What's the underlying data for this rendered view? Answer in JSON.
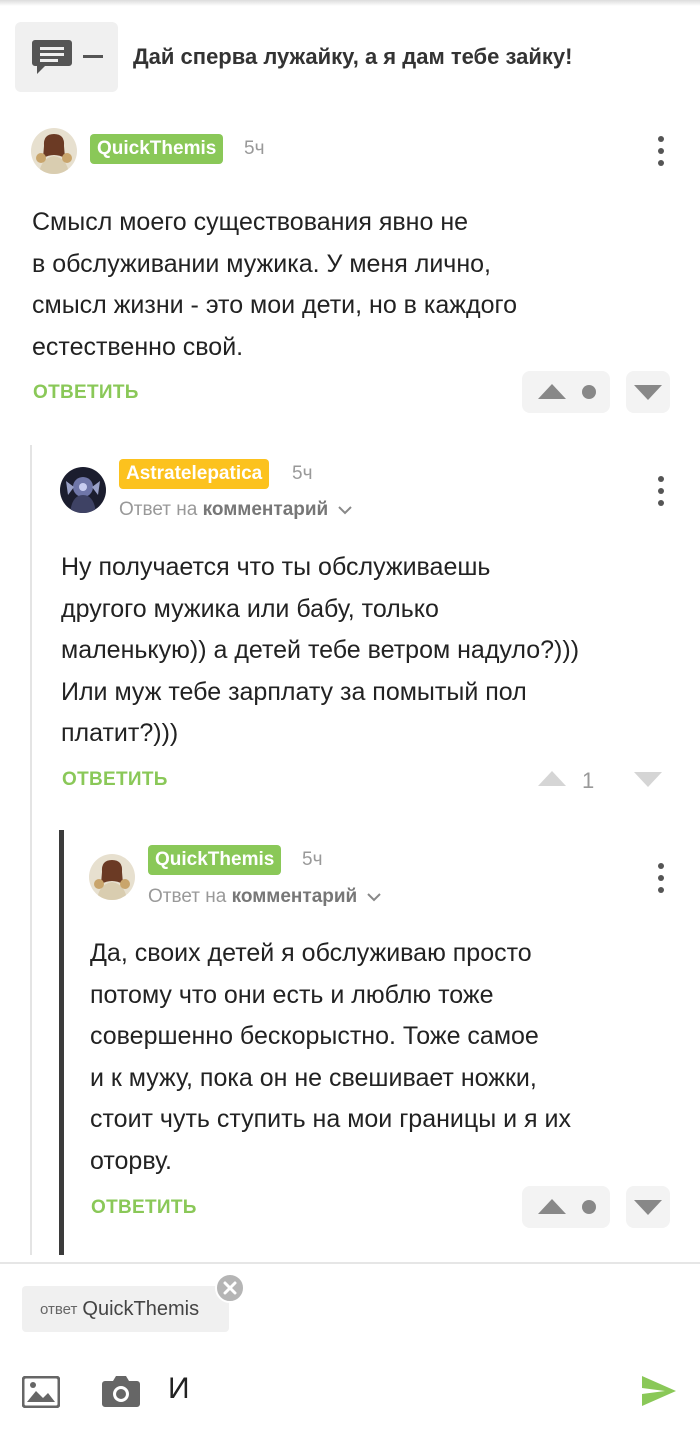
{
  "post": {
    "title": "Дай сперва лужайку, а я дам тебе зайку!"
  },
  "comments": [
    {
      "author": "QuickThemis",
      "time": "5ч",
      "text_lines": [
        "Смысл моего существования явно не",
        "в обслуживании мужика. У меня лично,",
        "смысл жизни - это мои дети, но в каждого",
        "естественно свой."
      ],
      "reply_label": "ОТВЕТИТЬ"
    },
    {
      "author": "Astratelepatica",
      "time": "5ч",
      "reply_to_prefix": "Ответ на",
      "reply_to_target": "комментарий",
      "text_lines": [
        "Ну получается что ты обслуживаешь",
        "другого мужика или бабу, только",
        "маленькую)) а детей тебе ветром надуло?)))",
        "Или муж тебе зарплату за помытый пол",
        "платит?)))"
      ],
      "reply_label": "ОТВЕТИТЬ",
      "score": "1"
    },
    {
      "author": "QuickThemis",
      "time": "5ч",
      "reply_to_prefix": "Ответ на",
      "reply_to_target": "комментарий",
      "text_lines": [
        "Да, своих детей я обслуживаю просто",
        "потому что они есть и люблю тоже",
        "совершенно бескорыстно. Тоже самое",
        "и к мужу, пока он не свешивает ножки,",
        "стоит чуть ступить на мои границы и я их",
        "оторву."
      ],
      "reply_label": "ОТВЕТИТЬ"
    }
  ],
  "composer": {
    "reply_chip_prefix": "ответ",
    "reply_chip_name": "QuickThemis",
    "input_value": "И"
  },
  "colors": {
    "accent_green": "#8ac858",
    "accent_yellow": "#fcc21e",
    "thread_line": "#3b3b3b"
  },
  "icons": [
    "comment-icon",
    "dash-icon",
    "more-vert-icon",
    "arrow-up-icon",
    "arrow-down-icon",
    "chevron-down-icon",
    "close-icon",
    "image-icon",
    "camera-icon",
    "send-icon"
  ]
}
